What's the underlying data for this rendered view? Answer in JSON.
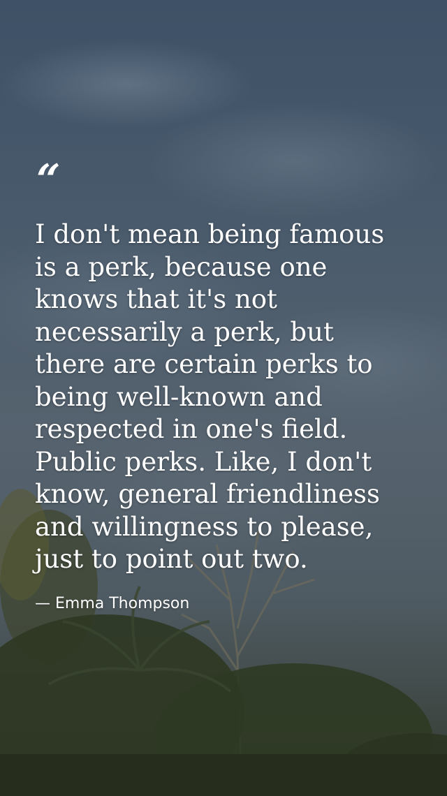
{
  "quote": {
    "mark": "“",
    "lines": [
      "I don't mean being famous",
      "is a perk, because one",
      "knows that it's not",
      "necessarily a perk, but",
      "there are certain perks to",
      "being well-known and",
      "respected in one's field.",
      "Public perks. Like, I don't",
      "know, general friendliness",
      "and willingness to please,",
      "just to point out two."
    ],
    "attribution": "— Emma Thompson"
  },
  "colors": {
    "text": "#ffffff",
    "sky": "#4a5b6c",
    "foliage": "#2f3a24"
  }
}
